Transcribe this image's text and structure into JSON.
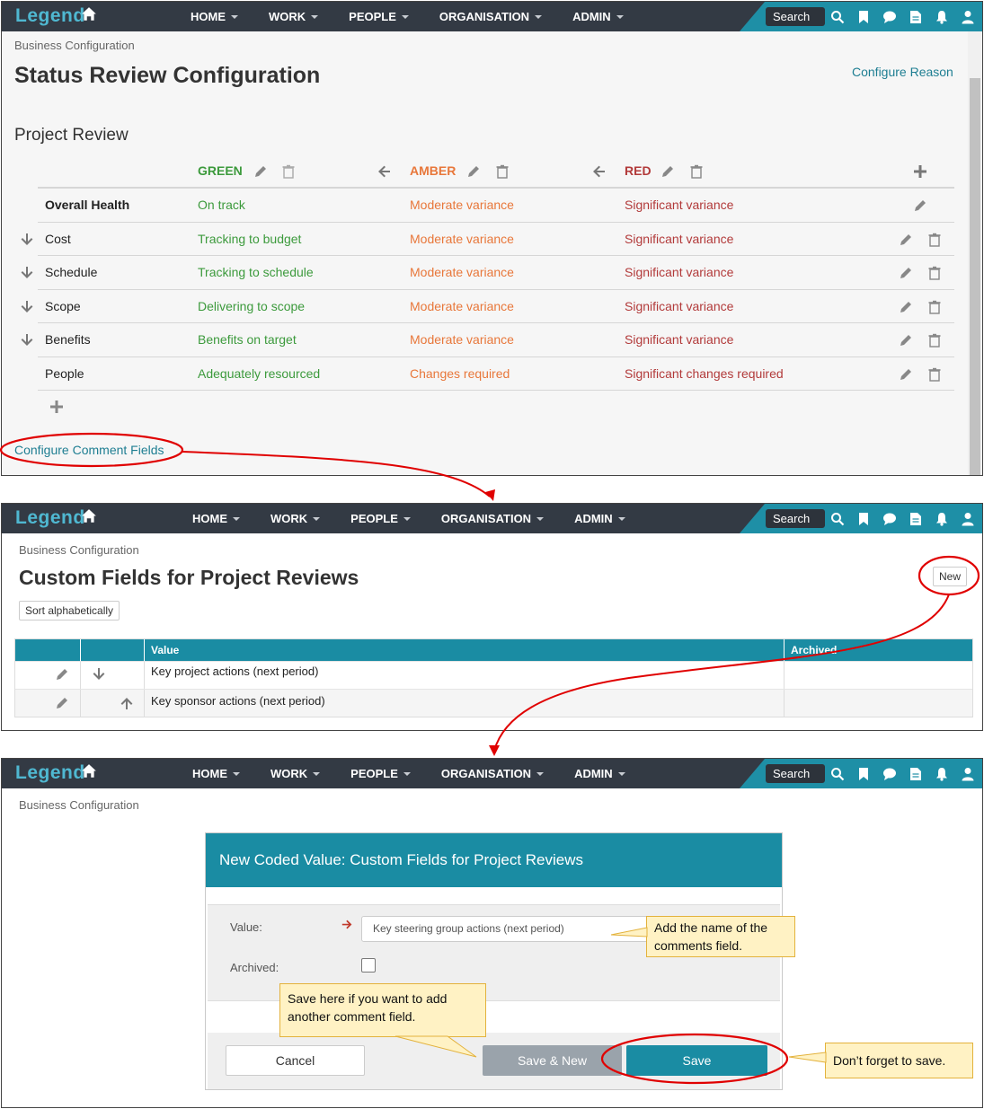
{
  "nav": {
    "logo": "Legend",
    "items": [
      "HOME",
      "WORK",
      "PEOPLE",
      "ORGANISATION",
      "ADMIN"
    ],
    "search_label": "Search"
  },
  "panel1": {
    "breadcrumb": "Business Configuration",
    "title": "Status Review Configuration",
    "configure_reason": "Configure Reason",
    "section_title": "Project Review",
    "headers": {
      "green": "GREEN",
      "amber": "AMBER",
      "red": "RED"
    },
    "rows": [
      {
        "label": "Overall Health",
        "green": "On track",
        "amber": "Moderate variance",
        "red": "Significant variance"
      },
      {
        "label": "Cost",
        "green": "Tracking to budget",
        "amber": "Moderate variance",
        "red": "Significant variance"
      },
      {
        "label": "Schedule",
        "green": "Tracking to schedule",
        "amber": "Moderate variance",
        "red": "Significant variance"
      },
      {
        "label": "Scope",
        "green": "Delivering to scope",
        "amber": "Moderate variance",
        "red": "Significant variance"
      },
      {
        "label": "Benefits",
        "green": "Benefits on target",
        "amber": "Moderate variance",
        "red": "Significant variance"
      },
      {
        "label": "People",
        "green": "Adequately resourced",
        "amber": "Changes required",
        "red": "Significant changes required"
      }
    ],
    "configure_comment_fields": "Configure Comment Fields"
  },
  "panel2": {
    "breadcrumb": "Business Configuration",
    "title": "Custom Fields for Project Reviews",
    "new_button": "New",
    "sort_button": "Sort alphabetically",
    "columns": {
      "value": "Value",
      "archived": "Archived"
    },
    "rows": [
      {
        "value": "Key project actions (next period)",
        "archived": ""
      },
      {
        "value": "Key sponsor actions (next period)",
        "archived": ""
      }
    ]
  },
  "panel3": {
    "breadcrumb": "Business Configuration",
    "dialog_title": "New Coded Value: Custom Fields for Project Reviews",
    "value_label": "Value:",
    "value_input": "Key steering group actions (next period)",
    "archived_label": "Archived:",
    "cancel": "Cancel",
    "save_new": "Save & New",
    "save": "Save"
  },
  "callouts": {
    "name_field": "Add the name of the comments field.",
    "save_new_tip": "Save here if you want to add another comment field.",
    "save_tip": "Don’t forget to save."
  },
  "colors": {
    "nav_bg": "#333a44",
    "accent": "#1a8ca3",
    "green": "#3c9a3c",
    "amber": "#e8773a",
    "red": "#b23a3a",
    "highlight": "#e00000",
    "callout_bg": "#fff2c4"
  }
}
